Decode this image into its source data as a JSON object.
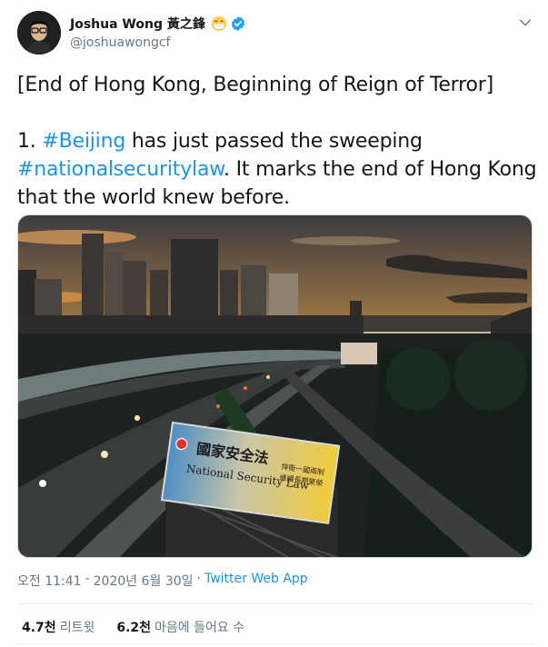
{
  "author": {
    "display_name": "Joshua Wong 黃之鋒",
    "handle": "@joshuawongcf",
    "verified": true
  },
  "tweet": {
    "line1": "[End of Hong Kong, Beginning of Reign of Terror]",
    "line2_prefix": "1. ",
    "hashtag1": "#Beijing",
    "line2_suffix": " has just passed the sweeping",
    "hashtag2": "#nationalsecuritylaw",
    "line3_suffix": ". It marks the end of Hong Kong",
    "line4": "that the world knew before."
  },
  "photo": {
    "billboard_chinese": "國家安全法",
    "billboard_english": "National Security Law",
    "billboard_right_1": "捍衛一國兩制",
    "billboard_right_2": "維護長期繁榮"
  },
  "meta": {
    "time": "오전 11:41",
    "date": "2020년 6월 30일",
    "separator": "·",
    "source": "Twitter Web App"
  },
  "stats": {
    "retweets_count": "4.7천",
    "retweets_label": "리트윗",
    "likes_count": "6.2천",
    "likes_label": "마음에 들어요 수"
  },
  "colors": {
    "link": "#1b95e0",
    "verified": "#1da1f2",
    "secondary_text": "#657786"
  },
  "icons": [
    "avatar",
    "smiling-face-with-mask-emoji",
    "verified-badge-icon",
    "chevron-down-icon"
  ]
}
